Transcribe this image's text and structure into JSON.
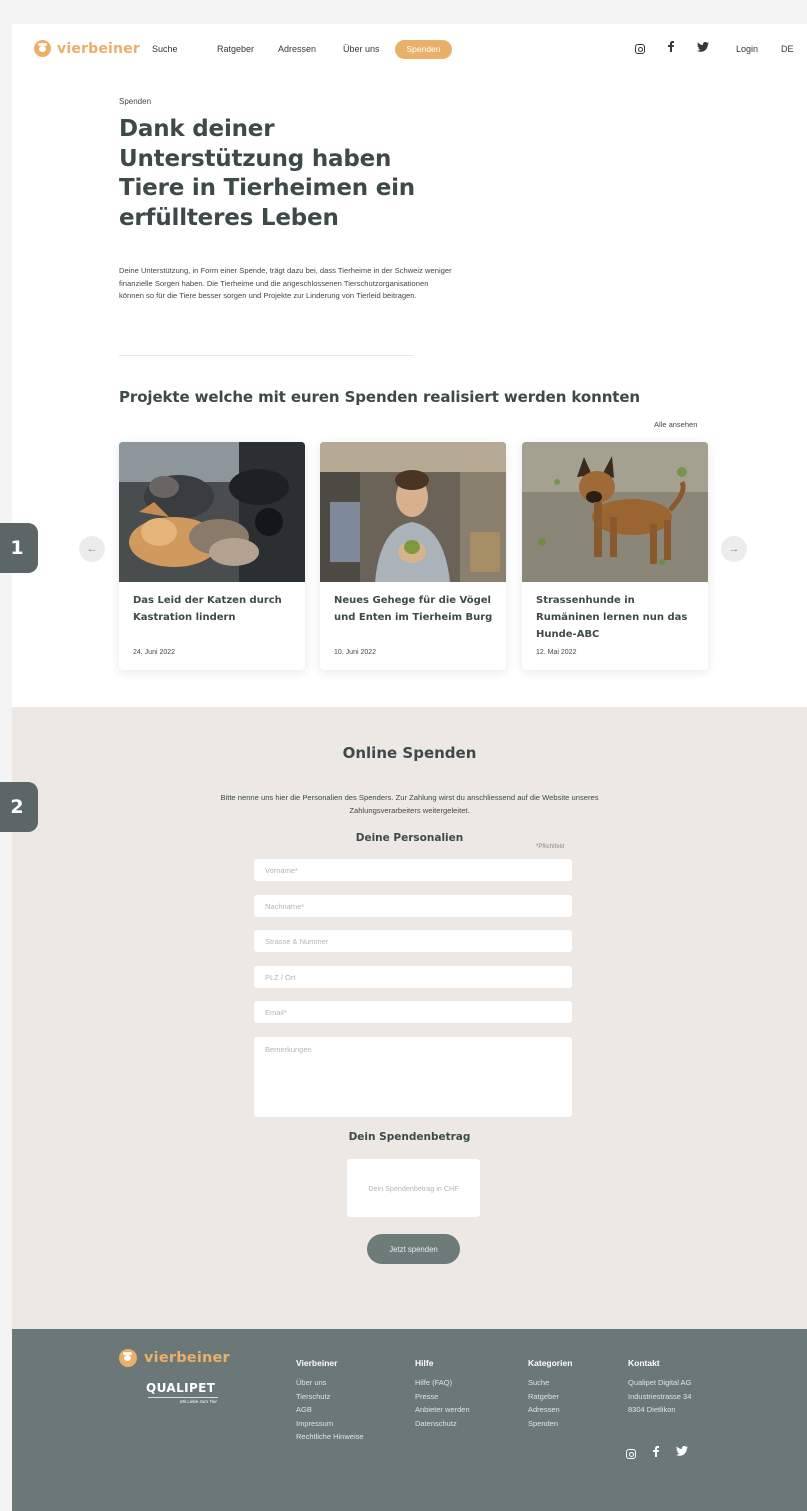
{
  "nav": {
    "logo": "vierbeiner",
    "links": [
      "Suche",
      "Ratgeber",
      "Adressen",
      "Über uns"
    ],
    "donate": "Spenden",
    "login": "Login",
    "lang": "DE"
  },
  "hero": {
    "breadcrumb": "Spenden",
    "title": "Dank deiner Unterstützung haben Tiere in Tierheimen ein erfüllteres Leben",
    "text": "Deine Unterstützung, in Form einer Spende, trägt dazu bei, dass Tierheime in der Schweiz weniger finanzielle Sorgen haben. Die Tierheime und die angeschlossenen Tierschutzorganisationen können so für die Tiere besser sorgen und Projekte zur Linderung von Tierleid beitragen."
  },
  "projects": {
    "heading": "Projekte welche mit euren Spenden realisiert werden konnten",
    "see_all": "Alle ansehen",
    "prev": "←",
    "next": "→",
    "cards": [
      {
        "title": "Das Leid der Katzen durch Kastration lindern",
        "date": "24. Juni 2022"
      },
      {
        "title": "Neues Gehege für die Vögel und Enten im Tierheim Burg",
        "date": "10. Juni 2022"
      },
      {
        "title": "Strassenhunde in Rumäninen lernen nun das Hunde-ABC",
        "date": "12. Mai 2022"
      }
    ]
  },
  "donation": {
    "title": "Online Spenden",
    "intro": "Bitte nenne uns hier die Personalien des Spenders. Zur Zahlung wirst du anschliessend auf die Website unseres Zahlungsverarbeiters weitergeleitet.",
    "personal_heading": "Deine Personalien",
    "required_note": "*Pflichtfeld",
    "fields": {
      "firstname": "Vorname*",
      "lastname": "Nachname*",
      "street": "Strasse & Nummer",
      "city": "PLZ / Ort",
      "email": "Email*",
      "remarks": "Bemerkungen"
    },
    "amount_heading": "Dein Spendenbetrag",
    "amount_placeholder": "Dein Spendenbetrag in CHF",
    "submit": "Jetzt spenden"
  },
  "footer": {
    "logo": "vierbeiner",
    "qualipet": "QUALIPET",
    "qualipet_tagline": "Mit Liebe zum Tier",
    "columns": [
      {
        "heading": "Vierbeiner",
        "items": [
          "Über uns",
          "Tierschutz",
          "AGB",
          "Impressum",
          "Rechtliche Hinweise"
        ]
      },
      {
        "heading": "Hilfe",
        "items": [
          "Hilfe (FAQ)",
          "Presse",
          "Anbieter werden",
          "Datenschutz"
        ]
      },
      {
        "heading": "Kategorien",
        "items": [
          "Suche",
          "Ratgeber",
          "Adressen",
          "Spenden"
        ]
      },
      {
        "heading": "Kontakt",
        "items": [
          "Qualipet Digital AG",
          "Industriestrasse 34",
          "8304 Dietlikon"
        ]
      }
    ]
  },
  "badges": [
    "1",
    "2"
  ],
  "colors": {
    "accent": "#eab069",
    "text": "#3e4a49",
    "donation_bg": "#ede8e3",
    "footer_bg": "#6c7877",
    "button": "#6d7b79"
  },
  "icons": [
    "instagram-icon",
    "facebook-icon",
    "twitter-icon",
    "paw-logo-icon",
    "arrow-left-icon",
    "arrow-right-icon"
  ]
}
